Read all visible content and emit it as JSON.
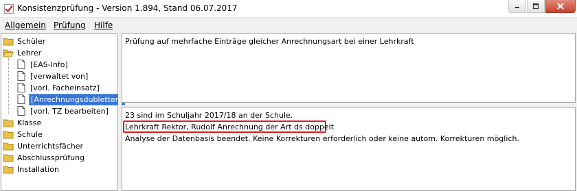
{
  "window": {
    "title": "Konsistenzprüfung - Version 1.894, Stand 06.07.2017",
    "icon": "checkmark-icon",
    "buttons": [
      "minimize-icon",
      "maximize-icon",
      "close-icon"
    ]
  },
  "menu": [
    {
      "label": "Allgemein"
    },
    {
      "label": "Prüfung"
    },
    {
      "label": "Hilfe"
    }
  ],
  "tree": {
    "items": [
      {
        "label": "Schüler",
        "type": "folder"
      },
      {
        "label": "Lehrer",
        "type": "folder-open"
      },
      {
        "label": "[EAS-Info]",
        "type": "file"
      },
      {
        "label": "[verwaltet von]",
        "type": "file"
      },
      {
        "label": "[vorl. Facheinsatz]",
        "type": "file"
      },
      {
        "label": "[Anrechnungsdubletten]",
        "type": "file",
        "selected": true
      },
      {
        "label": "[vorl. TZ bearbeiten]",
        "type": "file"
      },
      {
        "label": "Klasse",
        "type": "folder"
      },
      {
        "label": "Schule",
        "type": "folder"
      },
      {
        "label": "Unterrichtsfächer",
        "type": "folder"
      },
      {
        "label": "Abschlussprüfung",
        "type": "folder"
      },
      {
        "label": "Installation",
        "type": "folder"
      }
    ]
  },
  "description": {
    "text": "Prüfung auf mehrfache Einträge gleicher Anrechnungsart bei einer Lehrkraft"
  },
  "results": {
    "lines": [
      "23 sind im Schuljahr 2017/18 an der Schule.",
      "Lehrkraft Rektor, Rudolf Anrechnung der Art ds doppelt",
      "Analyse der Datenbasis beendet. Keine Korrekturen erforderlich oder keine autom. Korrekturen möglich."
    ],
    "highlight_color": "#e01b1b"
  },
  "colors": {
    "selection": "#3875d7",
    "folder": "#e8c24a"
  }
}
